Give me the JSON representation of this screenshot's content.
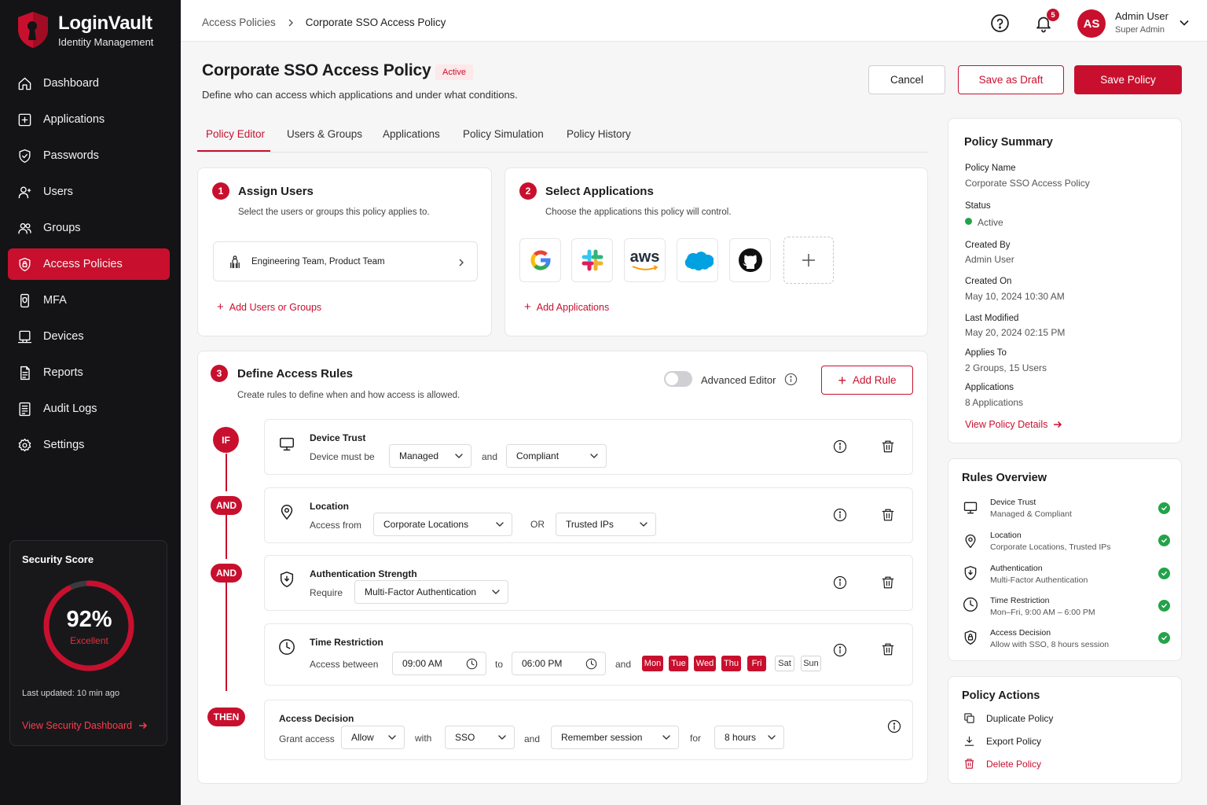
{
  "app": {
    "name": "LoginVault",
    "subtitle": "Identity Management"
  },
  "sidebar": {
    "items": [
      {
        "label": "Dashboard",
        "icon": "home-icon"
      },
      {
        "label": "Applications",
        "icon": "grid-plus-icon"
      },
      {
        "label": "Passwords",
        "icon": "shield-check-icon"
      },
      {
        "label": "Users",
        "icon": "user-icon"
      },
      {
        "label": "Groups",
        "icon": "users-icon"
      },
      {
        "label": "Access Policies",
        "icon": "shield-lock-icon",
        "active": true
      },
      {
        "label": "MFA",
        "icon": "phone-shield-icon"
      },
      {
        "label": "Devices",
        "icon": "laptop-icon"
      },
      {
        "label": "Reports",
        "icon": "document-icon"
      },
      {
        "label": "Audit Logs",
        "icon": "list-icon"
      },
      {
        "label": "Settings",
        "icon": "gear-icon"
      }
    ],
    "security": {
      "title": "Security Score",
      "value": "92%",
      "percent": 92,
      "rating": "Excellent",
      "updated": "Last updated: 10 min ago",
      "link": "View Security Dashboard"
    }
  },
  "header": {
    "breadcrumb": [
      "Access Policies",
      "Corporate SSO Access Policy"
    ],
    "notifications": "5",
    "user": {
      "initials": "AS",
      "name": "Admin User",
      "role": "Super Admin"
    }
  },
  "page": {
    "title": "Corporate SSO Access Policy",
    "status": "Active",
    "description": "Define who can access which applications and under what conditions.",
    "buttons": {
      "cancel": "Cancel",
      "draft": "Save as Draft",
      "save": "Save Policy"
    },
    "tabs": [
      "Policy Editor",
      "Users & Groups",
      "Applications",
      "Policy Simulation",
      "Policy History"
    ]
  },
  "assign": {
    "num": "1",
    "title": "Assign Users",
    "subtitle": "Select the users or groups this policy applies to.",
    "selected": "Engineering Team, Product Team",
    "add": "Add Users or Groups"
  },
  "apps": {
    "num": "2",
    "title": "Select Applications",
    "subtitle": "Choose the applications this policy will control.",
    "aws_label": "aws",
    "add": "Add Applications"
  },
  "rules": {
    "num": "3",
    "title": "Define Access Rules",
    "subtitle": "Create rules to define when and how access is allowed.",
    "advanced": "Advanced Editor",
    "add_rule": "Add Rule",
    "connectors": {
      "if": "IF",
      "and1": "AND",
      "and2": "AND",
      "then": "THEN"
    },
    "device": {
      "title": "Device Trust",
      "label": "Device must be",
      "value1": "Managed",
      "join": "and",
      "value2": "Compliant"
    },
    "location": {
      "title": "Location",
      "label": "Access from",
      "value1": "Corporate Locations",
      "join": "OR",
      "value2": "Trusted IPs"
    },
    "auth": {
      "title": "Authentication Strength",
      "label": "Require",
      "value": "Multi-Factor Authentication"
    },
    "time": {
      "title": "Time Restriction",
      "label": "Access between",
      "start": "09:00 AM",
      "to": "to",
      "end": "06:00 PM",
      "join": "and",
      "days": [
        {
          "d": "Mon",
          "on": true
        },
        {
          "d": "Tue",
          "on": true
        },
        {
          "d": "Wed",
          "on": true
        },
        {
          "d": "Thu",
          "on": true
        },
        {
          "d": "Fri",
          "on": true
        },
        {
          "d": "Sat",
          "on": false
        },
        {
          "d": "Sun",
          "on": false
        }
      ]
    },
    "decision": {
      "title": "Access Decision",
      "label": "Grant access",
      "action": "Allow",
      "with": "with",
      "method": "SSO",
      "and": "and",
      "remember": "Remember session",
      "for": "for",
      "duration": "8 hours"
    }
  },
  "summary": {
    "title": "Policy Summary",
    "fields": [
      {
        "k": "Policy Name",
        "v": "Corporate SSO Access Policy"
      },
      {
        "k": "Status",
        "v": "Active"
      },
      {
        "k": "Created By",
        "v": "Admin User"
      },
      {
        "k": "Created On",
        "v": "May 10, 2024 10:30 AM"
      },
      {
        "k": "Last Modified",
        "v": "May 20, 2024 02:15 PM"
      },
      {
        "k": "Applies To",
        "v": "2 Groups, 15 Users"
      },
      {
        "k": "Applications",
        "v": "8 Applications"
      }
    ],
    "link": "View Policy Details"
  },
  "overview": {
    "title": "Rules Overview",
    "items": [
      {
        "t": "Device Trust",
        "s": "Managed & Compliant"
      },
      {
        "t": "Location",
        "s": "Corporate Locations, Trusted IPs"
      },
      {
        "t": "Authentication",
        "s": "Multi-Factor Authentication"
      },
      {
        "t": "Time Restriction",
        "s": "Mon–Fri, 9:00 AM – 6:00 PM"
      },
      {
        "t": "Access Decision",
        "s": "Allow with SSO, 8 hours session"
      }
    ]
  },
  "actions": {
    "title": "Policy Actions",
    "items": [
      "Duplicate Policy",
      "Export Policy",
      "Delete Policy"
    ]
  },
  "colors": {
    "brand": "#c8102e",
    "sidebar": "#141416",
    "success": "#22a34a"
  }
}
